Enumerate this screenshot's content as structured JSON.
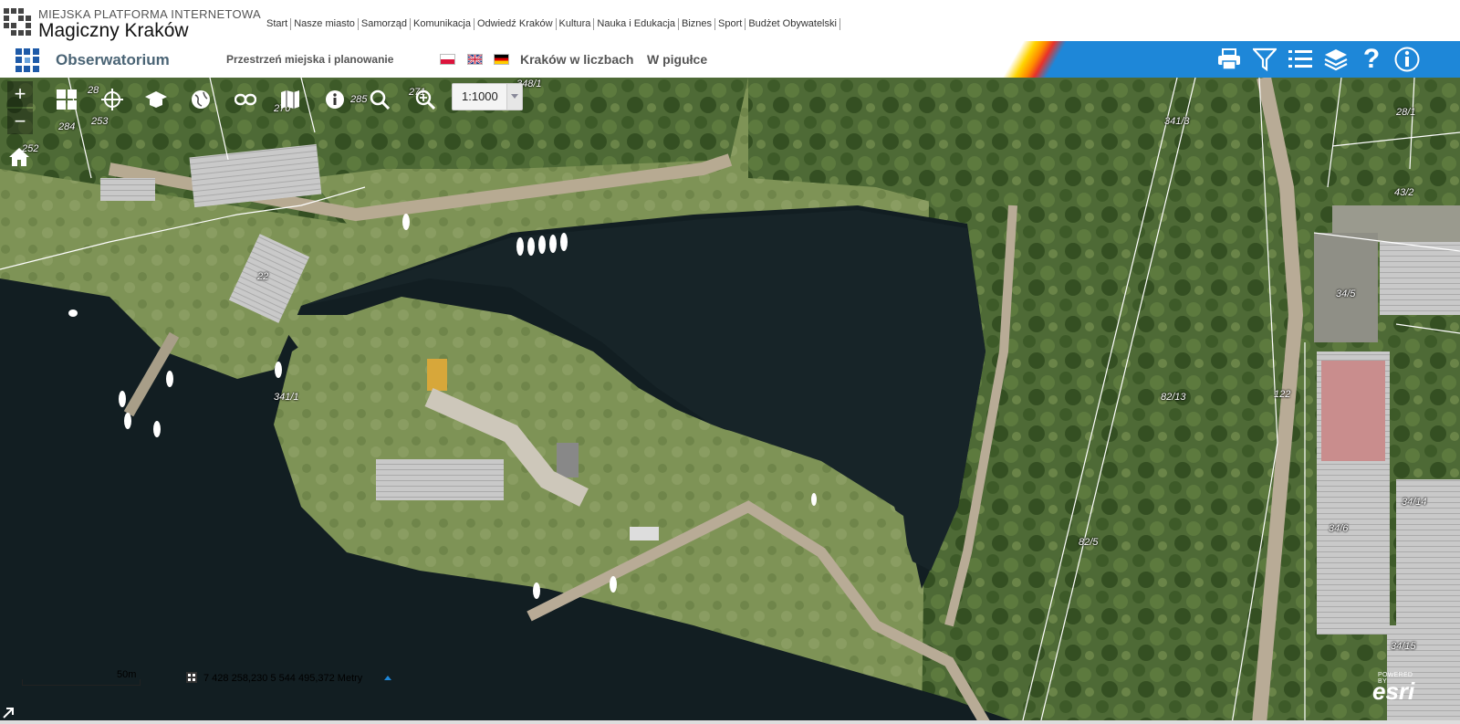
{
  "header": {
    "subtitle": "MIEJSKA PLATFORMA INTERNETOWA",
    "title": "Magiczny Kraków",
    "nav": [
      "Start",
      "Nasze miasto",
      "Samorząd",
      "Komunikacja",
      "Odwiedź Kraków",
      "Kultura",
      "Nauka i Edukacja",
      "Biznes",
      "Sport",
      "Budżet Obywatelski"
    ]
  },
  "subheader": {
    "app_title": "Obserwatorium",
    "theme": "Przestrzeń miejska i planowanie",
    "link_numbers": "Kraków w liczbach",
    "link_summary": "W pigułce",
    "accent": "#1e87d8"
  },
  "map": {
    "scale": "1:1000",
    "scalebar_label": "50m",
    "coordinates": "7 428 258,230  5 544 495,372 Metry",
    "attribution_top": "POWERED BY",
    "attribution": "esri",
    "parcels": [
      "284",
      "253",
      "252",
      "28",
      "270",
      "285",
      "271",
      "348/1",
      "341/3",
      "28/1",
      "43/2",
      "22",
      "34/5",
      "341/1",
      "82/13",
      "122",
      "82/5",
      "34/14",
      "34/6",
      "34/15"
    ]
  },
  "icons": [
    "zoom-in-icon",
    "zoom-out-icon",
    "home-icon",
    "basemap-grid-icon",
    "measure-icon",
    "print-map-icon",
    "globe-icon",
    "link-icon",
    "map-book-icon",
    "info-icon",
    "search-icon",
    "zoom-search-icon",
    "print-icon",
    "filter-icon",
    "list-icon",
    "layers-icon",
    "help-icon",
    "about-icon"
  ]
}
